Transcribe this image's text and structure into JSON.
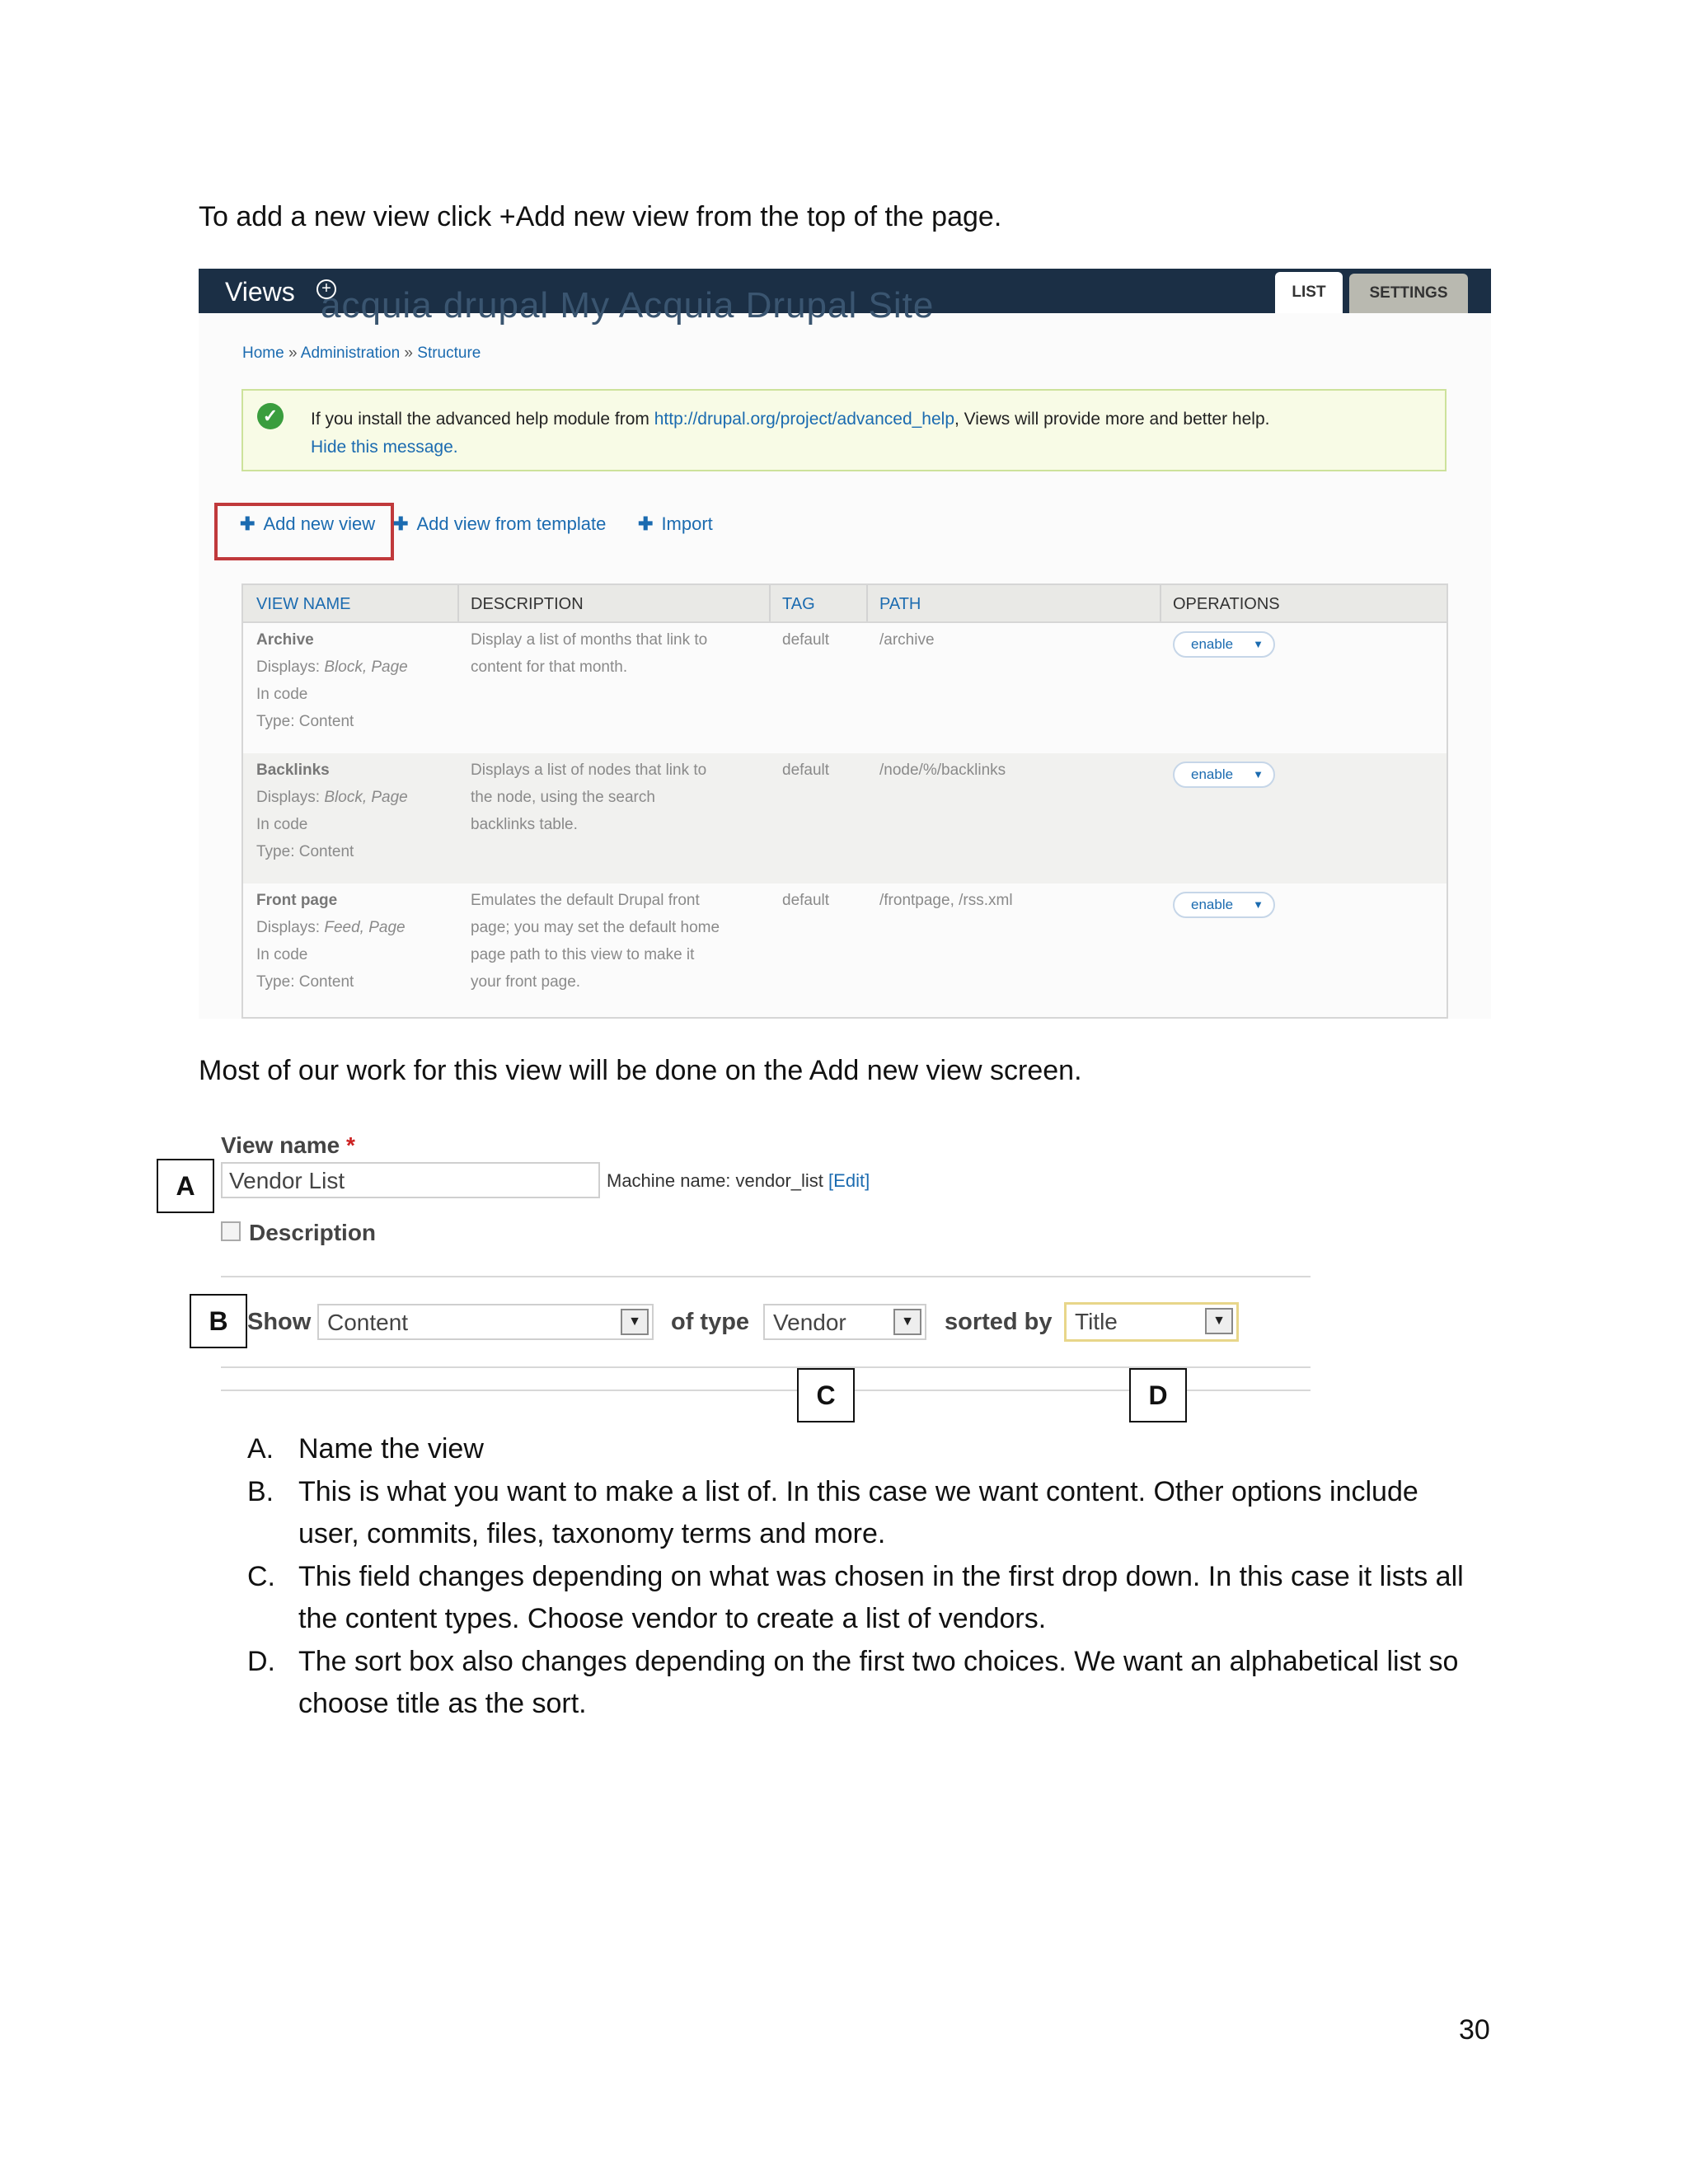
{
  "intro_text": "To add a new view click +Add new view from the top of the page.",
  "views_screen": {
    "title": "Views",
    "site_ghost_text": "acquia drupal   My Acquia Drupal Site",
    "tabs": {
      "list": "LIST",
      "settings": "SETTINGS"
    },
    "breadcrumb": [
      "Home",
      "Administration",
      "Structure"
    ],
    "message": {
      "text_before_link": "If you install the advanced help module from ",
      "link": "http://drupal.org/project/advanced_help",
      "text_after_link": ", Views will provide more and better help.",
      "hide": "Hide this message."
    },
    "actions": {
      "add_new_view": "Add new view",
      "add_from_template": "Add view from template",
      "import": "Import"
    },
    "table": {
      "headers": [
        "VIEW NAME",
        "DESCRIPTION",
        "TAG",
        "PATH",
        "OPERATIONS"
      ],
      "rows": [
        {
          "name": "Archive",
          "displays_label": "Displays: ",
          "displays": "Block, Page",
          "storage": "In code",
          "type": "Type: Content",
          "desc": [
            "Display a list of months that link to",
            "content for that month."
          ],
          "tag": "default",
          "path": "/archive",
          "op": "enable"
        },
        {
          "name": "Backlinks",
          "displays_label": "Displays: ",
          "displays": "Block, Page",
          "storage": "In code",
          "type": "Type: Content",
          "desc": [
            "Displays a list of nodes that link to",
            "the node, using the search",
            "backlinks table."
          ],
          "tag": "default",
          "path": "/node/%/backlinks",
          "op": "enable"
        },
        {
          "name": "Front page",
          "displays_label": "Displays: ",
          "displays": "Feed, Page",
          "storage": "In code",
          "type": "Type: Content",
          "desc": [
            "Emulates the default Drupal front",
            "page; you may set the default home",
            "page path to this view to make it",
            "your front page."
          ],
          "tag": "default",
          "path": "/frontpage, /rss.xml",
          "op": "enable"
        }
      ]
    }
  },
  "mid_text": "Most of our work for this view will be done on the Add new view screen.",
  "add_view_form": {
    "view_name_label": "View name",
    "required_mark": "*",
    "view_name_value": "Vendor List",
    "machine_name_text": "Machine name: vendor_list",
    "edit_link": "[Edit]",
    "description_label": "Description",
    "show_label": "Show",
    "show_value": "Content",
    "of_type_label": "of type",
    "of_type_value": "Vendor",
    "sorted_by_label": "sorted by",
    "sorted_by_value": "Title",
    "callouts": {
      "a": "A",
      "b": "B",
      "c": "C",
      "d": "D"
    }
  },
  "notes": [
    {
      "letter": "A.",
      "text": "Name the view"
    },
    {
      "letter": "B.",
      "text": "This is what you want to make a list of.  In this case we want content.  Other options include user, commits, files, taxonomy terms and more."
    },
    {
      "letter": "C.",
      "text": "This field changes depending on what was chosen in the first drop down.  In this case it lists all the content types.  Choose vendor to create a list of vendors."
    },
    {
      "letter": "D.",
      "text": "The sort box also changes depending on the first two choices.  We want an alphabetical list so choose title as the sort."
    }
  ],
  "page_number": "30"
}
